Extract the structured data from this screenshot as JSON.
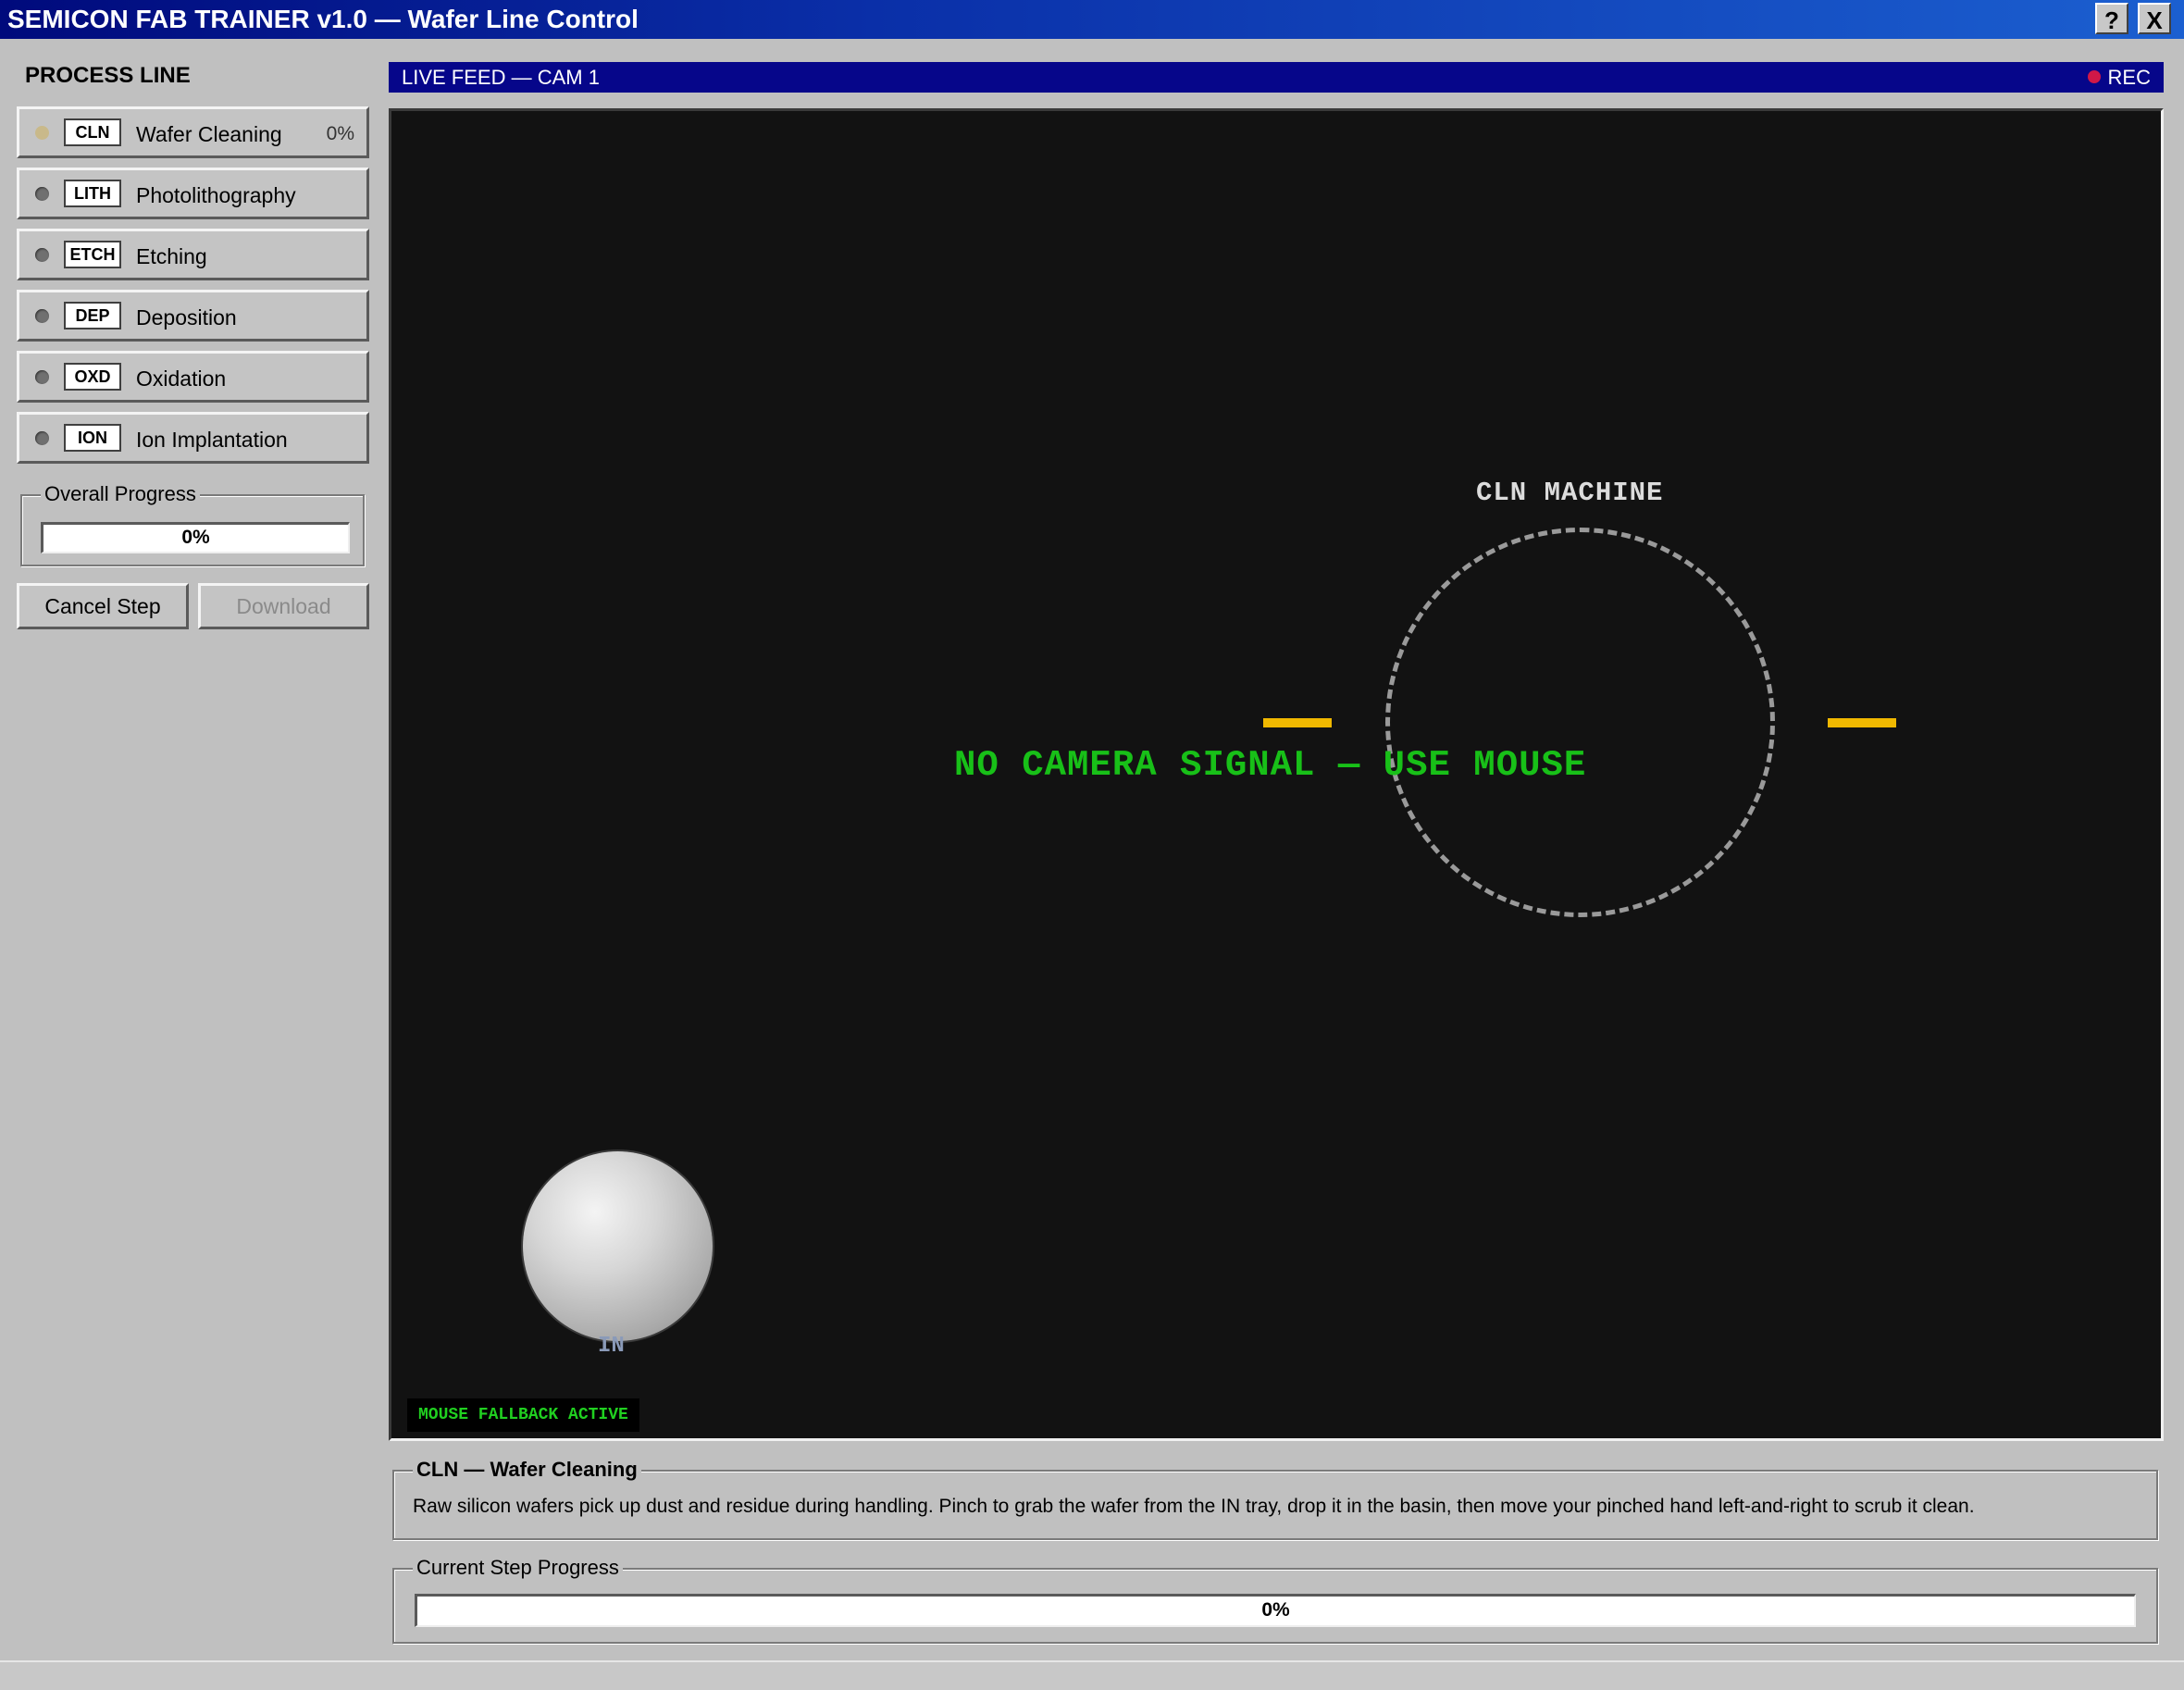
{
  "window": {
    "title": "SEMICON FAB TRAINER v1.0 — Wafer Line Control",
    "help_label": "?",
    "close_label": "X"
  },
  "sidebar": {
    "title": "PROCESS LINE",
    "steps": [
      {
        "code": "CLN",
        "label": "Wafer Cleaning",
        "progress": "0%",
        "active": true
      },
      {
        "code": "LITH",
        "label": "Photolithography",
        "progress": "",
        "active": false
      },
      {
        "code": "ETCH",
        "label": "Etching",
        "progress": "",
        "active": false
      },
      {
        "code": "DEP",
        "label": "Deposition",
        "progress": "",
        "active": false
      },
      {
        "code": "OXD",
        "label": "Oxidation",
        "progress": "",
        "active": false
      },
      {
        "code": "ION",
        "label": "Ion Implantation",
        "progress": "",
        "active": false
      }
    ],
    "overall_progress": {
      "label": "Overall Progress",
      "value_text": "0%",
      "fraction": 0
    },
    "cancel_label": "Cancel Step",
    "download_label": "Download"
  },
  "feed": {
    "header_label": "LIVE FEED — CAM 1",
    "rec_label": "REC",
    "machine_label": "CLN MACHINE",
    "status_text": "NO CAMERA SIGNAL — USE MOUSE",
    "tray_label": "IN",
    "fallback_badge": "MOUSE FALLBACK ACTIVE"
  },
  "description": {
    "title": "CLN — Wafer Cleaning",
    "text": "Raw silicon wafers pick up dust and residue during handling. Pinch to grab the wafer from the IN tray, drop it in the basin, then move your pinched hand left-and-right to scrub it clean."
  },
  "step_progress": {
    "label": "Current Step Progress",
    "value_text": "0%",
    "fraction": 0
  },
  "colors": {
    "title_bar": "#0a2fa8",
    "feed_header": "#06068a",
    "rec_dot": "#d01848",
    "status_green": "#18c018",
    "marker_amber": "#f0b800"
  }
}
